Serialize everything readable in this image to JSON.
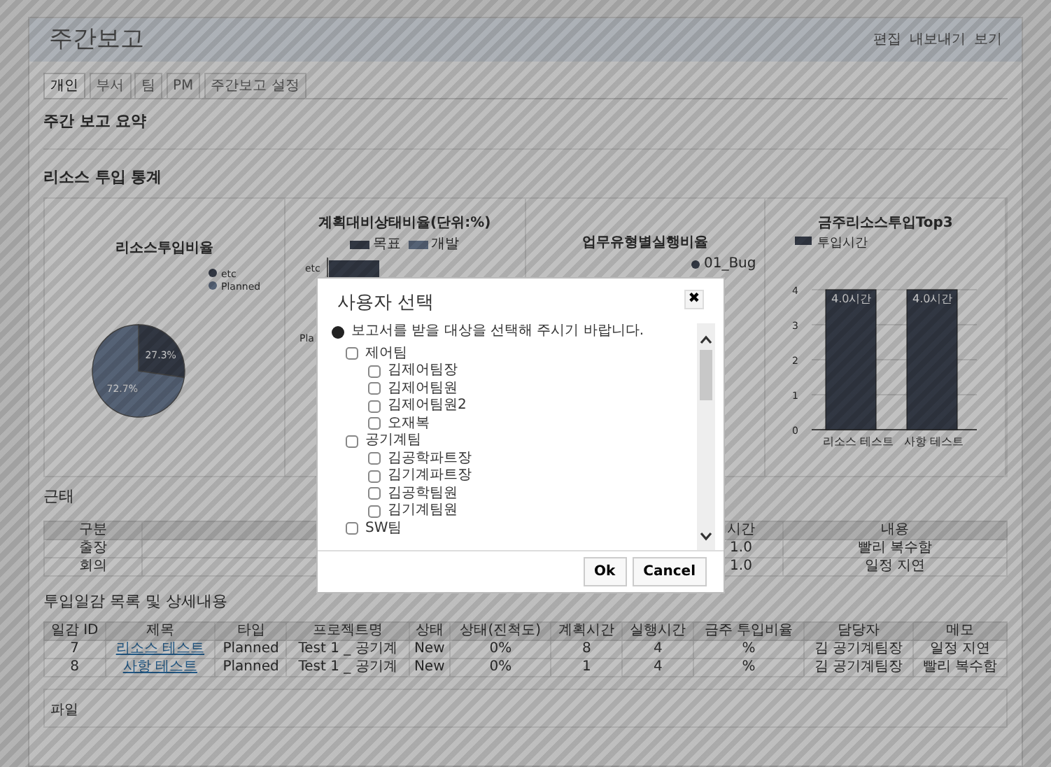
{
  "header": {
    "title": "주간보고",
    "links": [
      {
        "label": "편집"
      },
      {
        "label": "내보내기"
      },
      {
        "label": "보기"
      }
    ]
  },
  "tabs": [
    {
      "label": "개인",
      "selected": true
    },
    {
      "label": "부서",
      "selected": false
    },
    {
      "label": "팀",
      "selected": false
    },
    {
      "label": "PM",
      "selected": false
    },
    {
      "label": "주간보고 설정",
      "selected": false
    }
  ],
  "summary_title": "주간 보고 요약",
  "resource_title": "리소스 투입 통계",
  "charts": [
    {
      "chart_data": {
        "type": "pie",
        "title": "리소스투입비율",
        "categories": [
          "etc",
          "Planned"
        ],
        "values": [
          27.3,
          72.7
        ],
        "value_labels": [
          "27.3%",
          "72.7%"
        ],
        "legend": "right"
      }
    },
    {
      "title": "계획대비상태비율(단위:%)",
      "legend": [
        "목표",
        "개발"
      ],
      "axis_labels": [
        "etc",
        "Pla"
      ]
    },
    {
      "title": "업무유형별실행비율",
      "legend": [
        "01_Bug"
      ]
    },
    {
      "chart_data": {
        "type": "bar",
        "title": "금주리소스투입Top3",
        "categories": [
          "리소스 테스트",
          "사항 테스트"
        ],
        "series": [
          {
            "name": "투입시간",
            "color": "#3f4655",
            "values": [
              4,
              4
            ]
          }
        ],
        "ylim": [
          0,
          4
        ],
        "yticks": [
          0,
          1,
          2,
          3,
          4
        ],
        "value_labels": [
          "4.0시간",
          "4.0시간"
        ],
        "legend": "top",
        "grid": true
      }
    }
  ],
  "attendance": {
    "title": "근태",
    "columns": [
      "구분",
      "시간",
      "내용"
    ],
    "rows": [
      {
        "type": "출장",
        "hours": "1.0",
        "content": "빨리 복수함"
      },
      {
        "type": "회의",
        "hours": "1.0",
        "content": "일정 지연"
      }
    ]
  },
  "tasks": {
    "title": "투입일감 목록 및 상세내용",
    "columns": [
      "일감 ID",
      "제목",
      "타입",
      "프로젝트명",
      "상태",
      "상태(진척도)",
      "계획시간",
      "실행시간",
      "금주 투입비율",
      "담당자",
      "메모"
    ],
    "rows": [
      [
        "7",
        "리소스 테스트",
        "Planned",
        "Test 1 _ 공기계",
        "New",
        "0%",
        "8",
        "4",
        "%",
        "김 공기계팀장",
        "일정 지연"
      ],
      [
        "8",
        "사항 테스트",
        "Planned",
        "Test 1 _ 공기계",
        "New",
        "0%",
        "1",
        "4",
        "%",
        "김 공기계팀장",
        "빨리 복수함"
      ]
    ]
  },
  "files": {
    "label": "파일"
  },
  "dialog": {
    "title": "사용자 선택",
    "close": "✖",
    "message": "보고서를 받을 대상을 선택해 주시기 바랍니다.",
    "tree": [
      {
        "label": "제어팀",
        "checked": false,
        "children": [
          {
            "label": "김제어팀장",
            "checked": false
          },
          {
            "label": "김제어팀원",
            "checked": false
          },
          {
            "label": "김제어팀원2",
            "checked": false
          },
          {
            "label": "오재복",
            "checked": false
          }
        ]
      },
      {
        "label": "공기계팀",
        "checked": false,
        "children": [
          {
            "label": "김공학파트장",
            "checked": false
          },
          {
            "label": "김기계파트장",
            "checked": false
          },
          {
            "label": "김공학팀원",
            "checked": false
          },
          {
            "label": "김기계팀원",
            "checked": false
          }
        ]
      },
      {
        "label": "SW팀",
        "checked": false
      }
    ],
    "buttons": [
      {
        "label": "Ok"
      },
      {
        "label": "Cancel"
      }
    ]
  }
}
